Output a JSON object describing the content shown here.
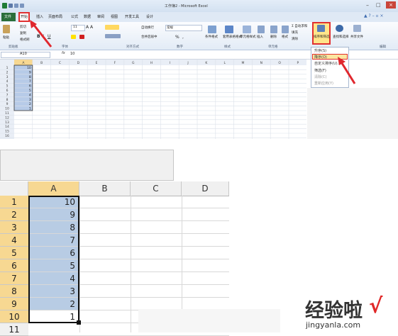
{
  "window": {
    "title": "工作簿2 - Microsoft Excel"
  },
  "tabs": [
    "文件",
    "开始",
    "插入",
    "页面布局",
    "公式",
    "数据",
    "审阅",
    "视图",
    "开发工具",
    "设计"
  ],
  "clipboard": {
    "paste": "粘贴",
    "cut": "剪切",
    "copy": "复制",
    "format_painter": "格式刷"
  },
  "font": {
    "size": "11",
    "bold": "B",
    "italic": "I",
    "underline": "U"
  },
  "alignment": {
    "wrap": "自动换行",
    "merge": "合并后居中"
  },
  "number": {
    "format": "常规",
    "percent": "%",
    "comma": ","
  },
  "styles": {
    "conditional": "条件格式",
    "table": "套用表格格式",
    "cell": "单元格样式"
  },
  "cells": {
    "insert": "插入",
    "delete": "删除",
    "format": "格式"
  },
  "editing": {
    "autosum": "Σ 自动求和",
    "fill": "填充",
    "clear": "清除",
    "sort_filter": "排序和筛选",
    "find_select": "查找和选择",
    "share": "共享文件"
  },
  "groups": [
    "剪贴板",
    "字体",
    "对齐方式",
    "数字",
    "样式",
    "单元格",
    "编辑"
  ],
  "namebox": "A10",
  "fx": "fx",
  "formula": "10",
  "sort_menu": {
    "items": [
      "升序(S)",
      "降序(O)",
      "自定义排序(U)...",
      "筛选(F)",
      "清除(C)",
      "重新应用(Y)"
    ],
    "highlight_index": 1
  },
  "small_grid": {
    "columns": [
      "A",
      "B",
      "C",
      "D",
      "E",
      "F",
      "G",
      "H",
      "I",
      "J",
      "K",
      "L",
      "M",
      "N",
      "O",
      "P"
    ],
    "rows": [
      "1",
      "2",
      "3",
      "4",
      "5",
      "6",
      "7",
      "8",
      "9",
      "10",
      "11",
      "12",
      "13",
      "14",
      "15",
      "16"
    ]
  },
  "big_grid": {
    "columns": [
      "A",
      "B",
      "C",
      "D"
    ],
    "rows": [
      "1",
      "2",
      "3",
      "4",
      "5",
      "6",
      "7",
      "8",
      "9",
      "10",
      "11"
    ],
    "values": [
      "10",
      "9",
      "8",
      "7",
      "6",
      "5",
      "4",
      "3",
      "2",
      "1"
    ]
  },
  "watermark": {
    "text": "经验啦",
    "check": "√",
    "url": "jingyanla.com"
  }
}
